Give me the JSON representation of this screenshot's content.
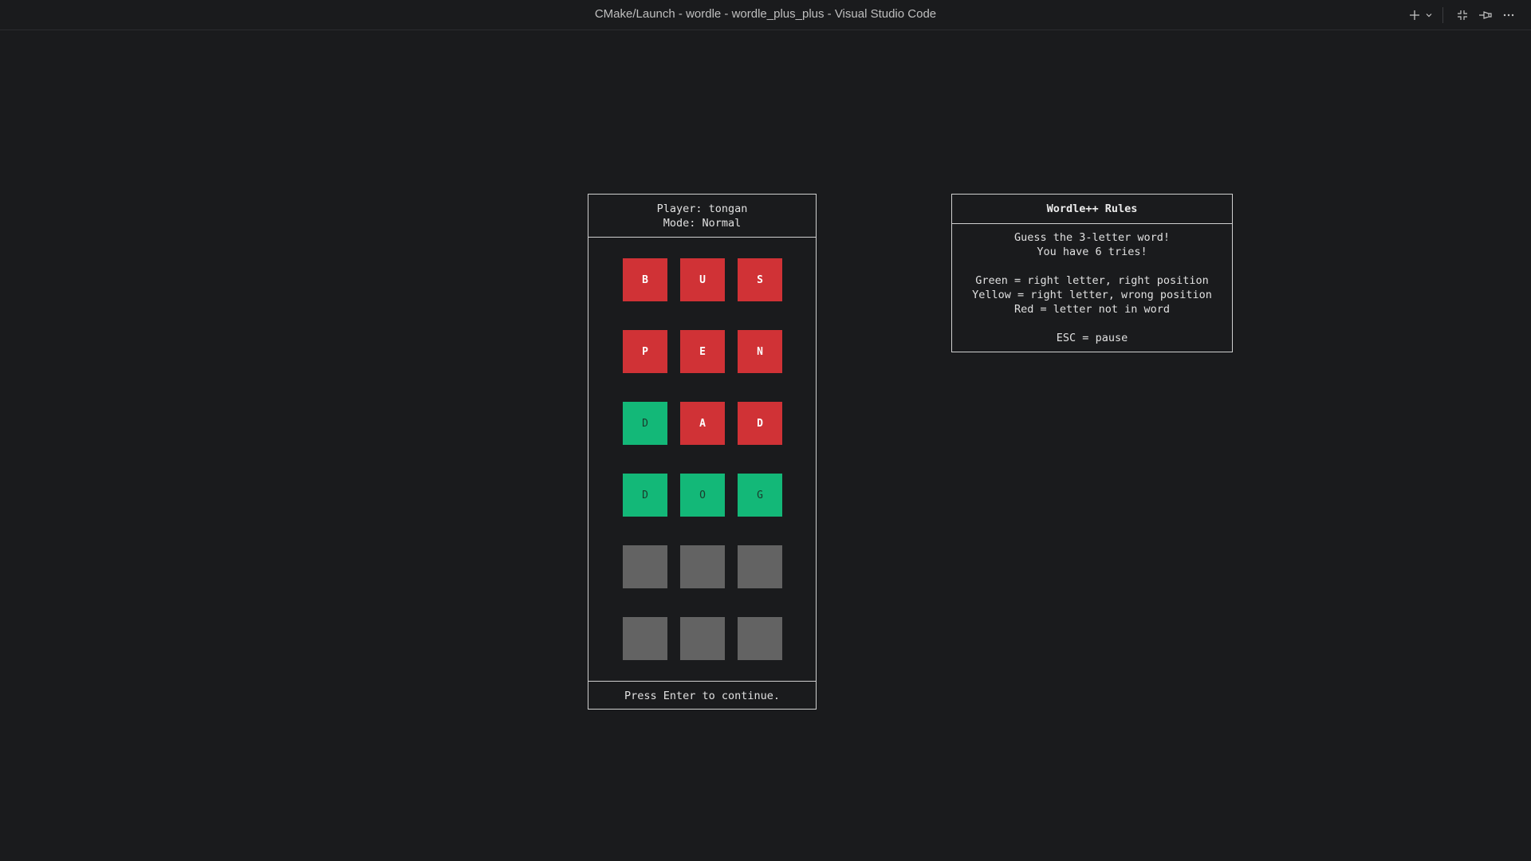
{
  "window": {
    "title": "CMake/Launch - wordle - wordle_plus_plus - Visual Studio Code",
    "icons": [
      "plus-icon",
      "chevron-down-icon",
      "exit-fullscreen-icon",
      "pin-icon",
      "more-icon"
    ]
  },
  "game": {
    "player_line": "Player: tongan",
    "mode_line": "Mode: Normal",
    "footer": "Press Enter to continue.",
    "colors": {
      "red": "#d03236",
      "green": "#13b878",
      "empty": "#636363"
    },
    "rows": [
      [
        {
          "letter": "B",
          "state": "red"
        },
        {
          "letter": "U",
          "state": "red"
        },
        {
          "letter": "S",
          "state": "red"
        }
      ],
      [
        {
          "letter": "P",
          "state": "red"
        },
        {
          "letter": "E",
          "state": "red"
        },
        {
          "letter": "N",
          "state": "red"
        }
      ],
      [
        {
          "letter": "D",
          "state": "green"
        },
        {
          "letter": "A",
          "state": "red"
        },
        {
          "letter": "D",
          "state": "red"
        }
      ],
      [
        {
          "letter": "D",
          "state": "green"
        },
        {
          "letter": "O",
          "state": "green"
        },
        {
          "letter": "G",
          "state": "green"
        }
      ],
      [
        {
          "letter": "",
          "state": "empty"
        },
        {
          "letter": "",
          "state": "empty"
        },
        {
          "letter": "",
          "state": "empty"
        }
      ],
      [
        {
          "letter": "",
          "state": "empty"
        },
        {
          "letter": "",
          "state": "empty"
        },
        {
          "letter": "",
          "state": "empty"
        }
      ]
    ]
  },
  "rules": {
    "title": "Wordle++ Rules",
    "lines": [
      "Guess the 3-letter word!",
      "You have 6 tries!",
      "",
      "Green = right letter, right position",
      "Yellow = right letter, wrong position",
      "Red = letter not in word",
      "",
      "ESC = pause"
    ]
  }
}
